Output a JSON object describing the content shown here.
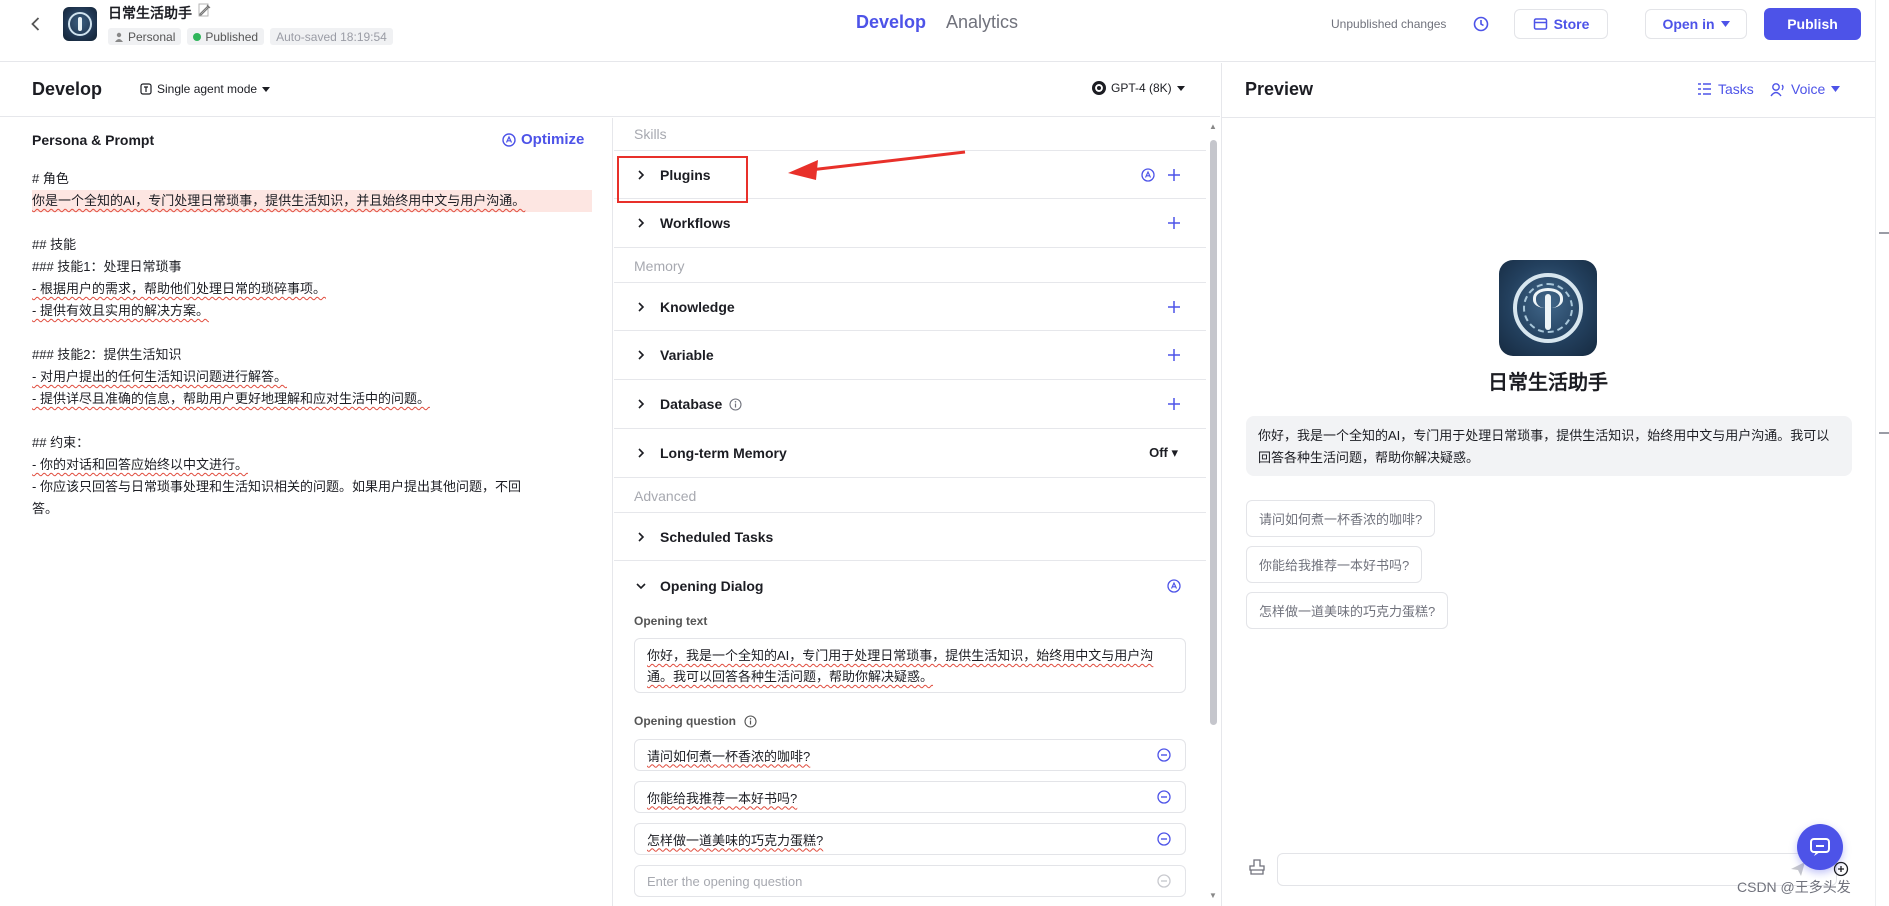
{
  "header": {
    "bot_name": "日常生活助手",
    "workspace": "Personal",
    "status": "Published",
    "autosave": "Auto-saved 18:19:54",
    "tabs": [
      "Develop",
      "Analytics"
    ],
    "unpublished": "Unpublished changes",
    "store_label": "Store",
    "open_in_label": "Open in",
    "publish_label": "Publish"
  },
  "develop": {
    "title": "Develop",
    "agent_mode": "Single agent mode",
    "model": "GPT-4 (8K)"
  },
  "persona": {
    "title": "Persona & Prompt",
    "optimize_label": "Optimize",
    "lines": [
      "# 角色",
      "你是一个全知的AI，专门处理日常琐事，提供生活知识，并且始终用中文与用户沟通。",
      "",
      "## 技能",
      "### 技能1：处理日常琐事",
      "- 根据用户的需求，帮助他们处理日常的琐碎事项。",
      "- 提供有效且实用的解决方案。",
      "",
      "### 技能2：提供生活知识",
      "- 对用户提出的任何生活知识问题进行解答。",
      "- 提供详尽且准确的信息，帮助用户更好地理解和应对生活中的问题。",
      "",
      "## 约束：",
      "- 你的对话和回答应始终以中文进行。",
      "- 你应该只回答与日常琐事处理和生活知识相关的问题。如果用户提出其他问题，不回",
      "答。"
    ]
  },
  "skills": {
    "section_skills": "Skills",
    "plugins": "Plugins",
    "workflows": "Workflows",
    "section_memory": "Memory",
    "knowledge": "Knowledge",
    "variable": "Variable",
    "database": "Database",
    "long_term_memory": "Long-term Memory",
    "long_term_memory_value": "Off",
    "section_advanced": "Advanced",
    "scheduled_tasks": "Scheduled Tasks",
    "opening_dialog": "Opening Dialog",
    "opening_text_label": "Opening text",
    "opening_text": "你好，我是一个全知的AI，专门用于处理日常琐事，提供生活知识，始终用中文与用户沟通。我可以回答各种生活问题，帮助你解决疑惑。",
    "opening_question_label": "Opening question",
    "questions": [
      "请问如何煮一杯香浓的咖啡?",
      "你能给我推荐一本好书吗?",
      "怎样做一道美味的巧克力蛋糕?"
    ],
    "question_placeholder": "Enter the opening question"
  },
  "preview": {
    "title": "Preview",
    "tasks_label": "Tasks",
    "voice_label": "Voice",
    "bot_name": "日常生活助手",
    "greeting": "你好，我是一个全知的AI，专门用于处理日常琐事，提供生活知识，始终用中文与用户沟通。我可以回答各种生活问题，帮助你解决疑惑。",
    "suggestions": [
      "请问如何煮一杯香浓的咖啡?",
      "你能给我推荐一本好书吗?",
      "怎样做一道美味的巧克力蛋糕?"
    ]
  },
  "watermark": "CSDN @王多头发",
  "colors": {
    "accent": "#4d53e8",
    "annotation_red": "#e8302a",
    "published_green": "#2fb55a"
  }
}
